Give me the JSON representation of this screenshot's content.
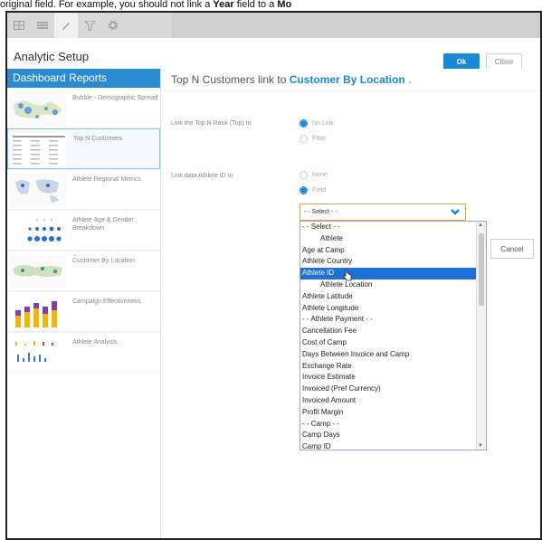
{
  "caption": {
    "before": "original field. For example, you should not link a ",
    "bold1": "Year",
    "middle": " field to a ",
    "bold2": "Mo"
  },
  "toolbar": {
    "icons": [
      "grid-icon",
      "list-icon",
      "pencil-icon",
      "filter-icon",
      "gear-icon"
    ]
  },
  "header": {
    "title": "Analytic Setup",
    "ok_label": "Ok",
    "close_label": "Close"
  },
  "sidebar": {
    "heading": "Dashboard Reports",
    "reports": [
      {
        "label": "Bubble - Demographic Spread"
      },
      {
        "label": "Top N Customers"
      },
      {
        "label": "Athlete Regional Metrics"
      },
      {
        "label": "Athlete Age & Gender Breakdown"
      },
      {
        "label": "Customer By Location"
      },
      {
        "label": "Campaign Effectiveness"
      },
      {
        "label": "Athlete Analysis"
      }
    ]
  },
  "main": {
    "title_prefix": "Top N Customers link to ",
    "title_link": "Customer By Location",
    "title_suffix": " .",
    "field1_label": "Link the Top N Rank (Top) to",
    "field1_opt1": "No Link",
    "field1_opt2": "Filter",
    "field2_label": "Link data Athlete ID to",
    "field2_opt1": "None",
    "field2_opt2": "Field",
    "select_value": "- - Select - -",
    "cancel_label": "Cancel"
  },
  "dropdown": {
    "items": [
      {
        "text": "- - Select - -",
        "indent": false,
        "hl": false
      },
      {
        "text": "Athlete",
        "indent": true,
        "hl": false
      },
      {
        "text": "Age at Camp",
        "indent": false,
        "hl": false
      },
      {
        "text": "Athlete Country",
        "indent": false,
        "hl": false
      },
      {
        "text": "Athlete ID",
        "indent": false,
        "hl": true
      },
      {
        "text": "Athlete Location",
        "indent": true,
        "hl": false
      },
      {
        "text": "Athlete Latitude",
        "indent": false,
        "hl": false
      },
      {
        "text": "Athlete Longitude",
        "indent": false,
        "hl": false
      },
      {
        "text": "- - Athlete Payment - -",
        "indent": false,
        "hl": false
      },
      {
        "text": "Cancellation Fee",
        "indent": false,
        "hl": false
      },
      {
        "text": "Cost of Camp",
        "indent": false,
        "hl": false
      },
      {
        "text": "Days Between Invoice and Camp",
        "indent": false,
        "hl": false
      },
      {
        "text": "Exchange Rate",
        "indent": false,
        "hl": false
      },
      {
        "text": "Invoice Estimate",
        "indent": false,
        "hl": false
      },
      {
        "text": "Invoiced (Pref Currency)",
        "indent": false,
        "hl": false
      },
      {
        "text": "Invoiced Amount",
        "indent": false,
        "hl": false
      },
      {
        "text": "Profit Margin",
        "indent": false,
        "hl": false
      },
      {
        "text": "- - Camp - -",
        "indent": false,
        "hl": false
      },
      {
        "text": "Camp Days",
        "indent": false,
        "hl": false
      },
      {
        "text": "Camp ID",
        "indent": false,
        "hl": false
      }
    ]
  },
  "colors": {
    "accent": "#1a88d6",
    "highlight": "#1e6fd6",
    "select_border": "#e6a23c"
  }
}
